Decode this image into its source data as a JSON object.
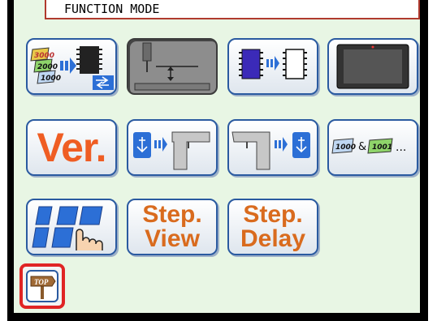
{
  "window": {
    "title": "FUNCTION MODE"
  },
  "buttons": {
    "data_copy": {
      "labels": [
        "3000",
        "2000",
        "1000"
      ]
    },
    "presser_height": {},
    "memory_copy": {},
    "panel_display": {},
    "version": {
      "label": "Ver."
    },
    "usb_to_machine": {},
    "machine_to_usb": {},
    "pattern_link": {
      "label_a": "1000",
      "amp": "&",
      "label_b": "1001",
      "ellipsis": "..."
    },
    "number_input": {},
    "step_view": {
      "line1": "Step.",
      "line2": "View"
    },
    "step_delay": {
      "line1": "Step.",
      "line2": "Delay"
    },
    "top": {
      "label": "TOP"
    }
  },
  "colors": {
    "background": "#e8f6e4",
    "frame": "#000000",
    "button_border": "#2a5aa0",
    "version_text": "#ef5d23",
    "step_text": "#d96b1e",
    "top_highlight": "#e02424"
  }
}
